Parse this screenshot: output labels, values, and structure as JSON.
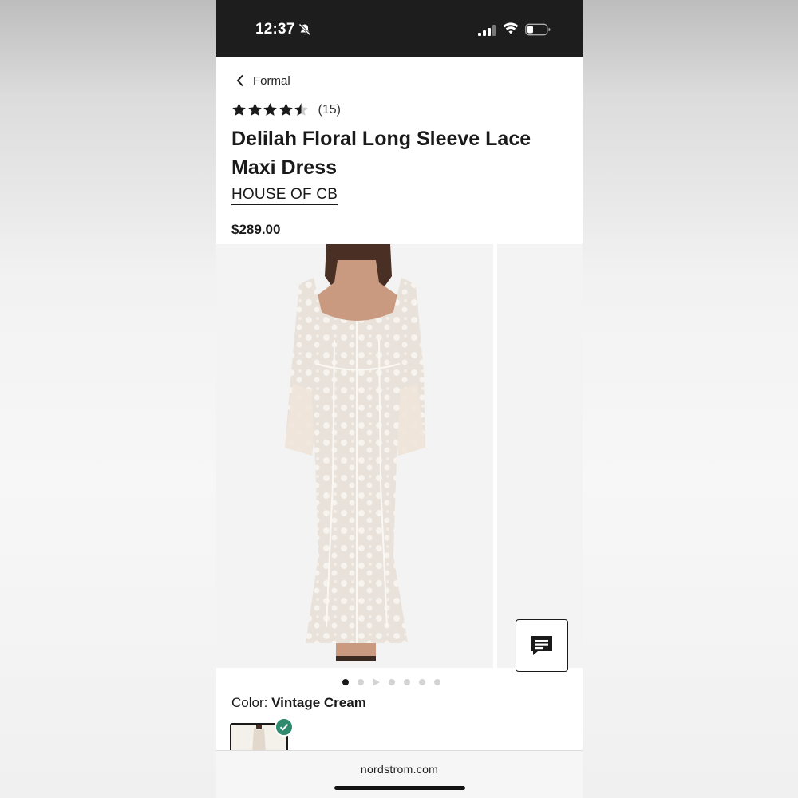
{
  "status_bar": {
    "time": "12:37",
    "icons": [
      "bell-slash-icon",
      "signal-icon",
      "wifi-icon",
      "battery-icon"
    ]
  },
  "header": {
    "back_label": "Formal",
    "back_icon": "chevron-left-icon"
  },
  "product": {
    "rating": 4.5,
    "rating_max": 5,
    "review_count": "(15)",
    "title": "Delilah Floral Long Sleeve Lace Maxi Dress",
    "brand": "HOUSE OF CB",
    "price": "$289.00"
  },
  "gallery": {
    "image_count": 7,
    "active_index": 0,
    "video_index": 2
  },
  "color": {
    "label": "Color: ",
    "value": "Vintage Cream"
  },
  "browser": {
    "url": "nordstrom.com"
  },
  "colors": {
    "status_bar_bg": "#1d1d1d",
    "check_badge": "#2e8b6e",
    "text": "#1a1a1a"
  }
}
